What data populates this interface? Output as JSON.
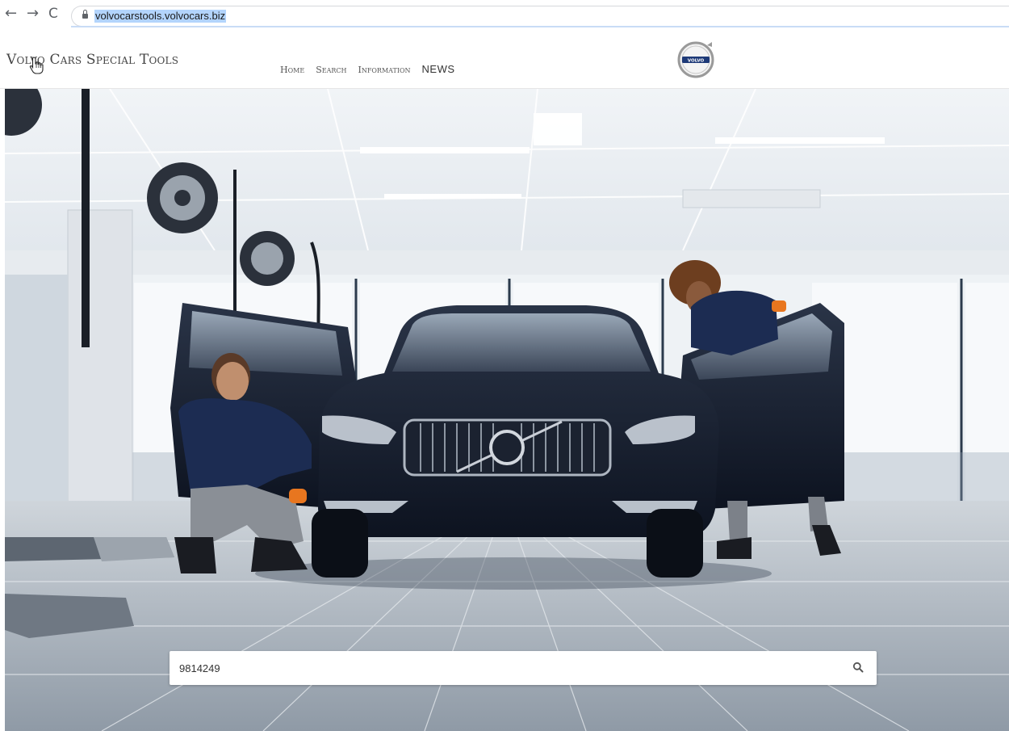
{
  "browser": {
    "back_icon": "←",
    "forward_icon": "→",
    "reload_icon": "C",
    "url": "volvocarstools.volvocars.biz"
  },
  "header": {
    "brand": "Volvo Cars Special Tools",
    "nav": {
      "home": "Home",
      "search": "Search",
      "information": "Information",
      "news": "NEWS"
    },
    "logo_text": "VOLVO"
  },
  "search": {
    "value": "9814249",
    "icon": "search-icon"
  },
  "colors": {
    "car": "#121a2b",
    "uniform": "#1c2c52",
    "hero_wall": "#e9eef3",
    "floor": "#b9c1ca"
  }
}
